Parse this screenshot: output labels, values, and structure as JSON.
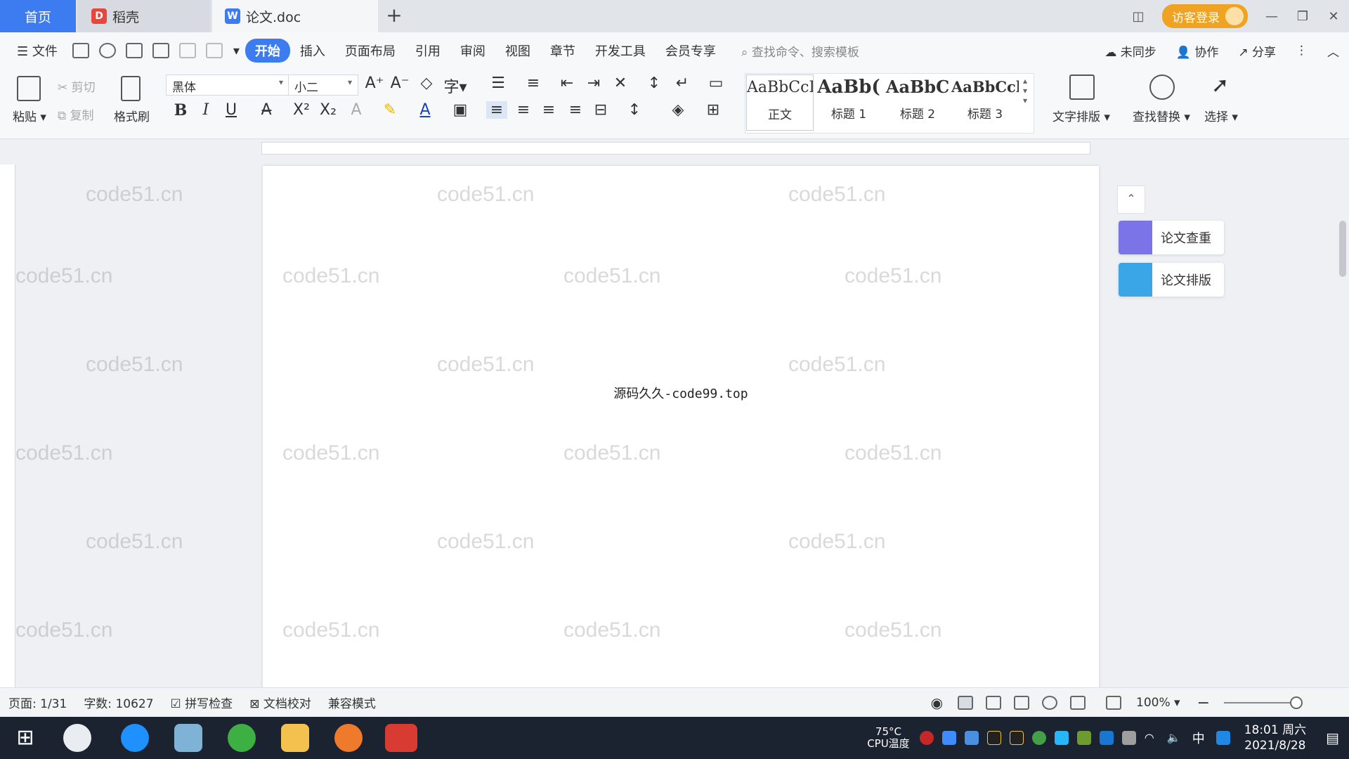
{
  "tabs": {
    "home": "首页",
    "docer": "稻壳",
    "doc": "论文.doc"
  },
  "titlebar": {
    "login": "访客登录"
  },
  "menu": {
    "file": "文件",
    "items": [
      "开始",
      "插入",
      "页面布局",
      "引用",
      "审阅",
      "视图",
      "章节",
      "开发工具",
      "会员专享"
    ],
    "search_placeholder": "查找命令、搜索模板",
    "sync": "未同步",
    "collab": "协作",
    "share": "分享"
  },
  "ribbon": {
    "paste": "粘贴",
    "cut": "剪切",
    "copy": "复制",
    "format_painter": "格式刷",
    "font_name": "黑体",
    "font_size": "小二",
    "bold": "B",
    "italic": "I",
    "underline": "U",
    "styles": [
      {
        "sample": "AaBbCcI",
        "label": "正文"
      },
      {
        "sample": "AaBb(",
        "label": "标题 1"
      },
      {
        "sample": "AaBbC",
        "label": "标题 2"
      },
      {
        "sample": "AaBbCcl",
        "label": "标题 3"
      }
    ],
    "text_layout": "文字排版",
    "find_replace": "查找替换",
    "select": "选择"
  },
  "document": {
    "body_text": "源码久久-code99.top",
    "watermark": "code51.cn"
  },
  "side_panel": {
    "check": "论文查重",
    "layout": "论文排版"
  },
  "status": {
    "page": "页面: 1/31",
    "word_count": "字数: 10627",
    "spell_check": "拼写检查",
    "doc_proof": "文档校对",
    "compat_mode": "兼容模式",
    "zoom": "100%"
  },
  "taskbar": {
    "cpu_temp": "75°C",
    "cpu_label": "CPU温度",
    "ime": "中",
    "time": "18:01 周六",
    "date": "2021/8/28"
  },
  "colors": {
    "accent": "#3c7bf0",
    "login": "#f0a222",
    "taskbar": "#1b2230"
  }
}
